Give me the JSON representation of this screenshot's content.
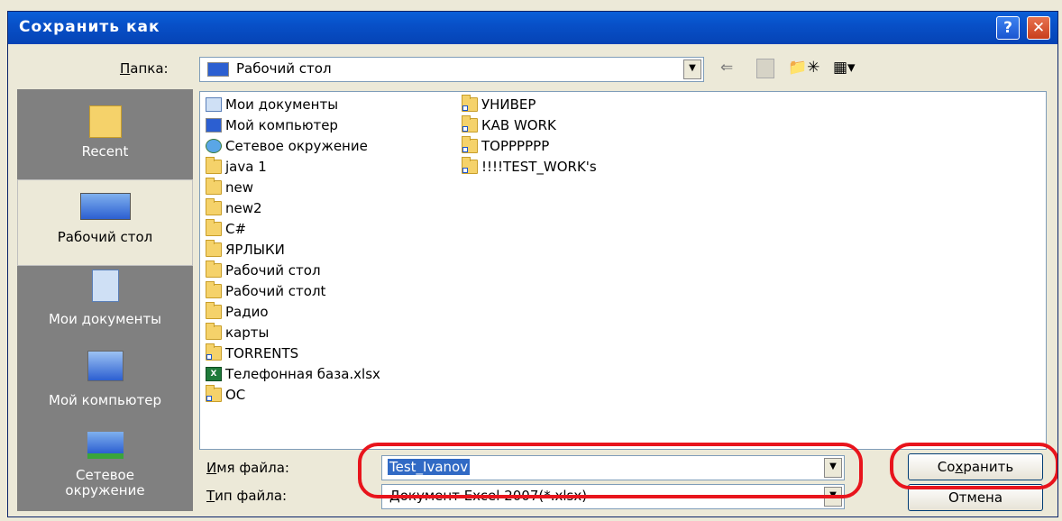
{
  "dialog": {
    "title": "Сохранить как",
    "help_glyph": "?",
    "close_glyph": "✕"
  },
  "folder_bar": {
    "label_u": "П",
    "label_rest": "апка:",
    "selected": "Рабочий стол",
    "icons": [
      "back-icon",
      "up-folder-icon",
      "new-folder-icon",
      "views-icon"
    ]
  },
  "places": [
    {
      "label": "Recent",
      "icon": "recent-folder-icon"
    },
    {
      "label": "Рабочий стол",
      "icon": "desktop-icon"
    },
    {
      "label": "Мои документы",
      "icon": "my-documents-icon"
    },
    {
      "label": "Мой компьютер",
      "icon": "my-computer-icon"
    },
    {
      "label_line1": "Сетевое",
      "label_line2": "окружение",
      "icon": "network-icon"
    }
  ],
  "files_col1": [
    {
      "name": "Мои документы",
      "icon": "my-documents-icon"
    },
    {
      "name": "Мой компьютер",
      "icon": "my-computer-icon"
    },
    {
      "name": "Сетевое окружение",
      "icon": "network-icon"
    },
    {
      "name": "java 1",
      "icon": "folder-icon"
    },
    {
      "name": "new",
      "icon": "folder-icon"
    },
    {
      "name": "new2",
      "icon": "folder-icon"
    },
    {
      "name": "C#",
      "icon": "folder-icon"
    },
    {
      "name": "ЯРЛЫКИ",
      "icon": "folder-icon"
    },
    {
      "name": "Рабочий стол",
      "icon": "folder-icon"
    },
    {
      "name": "Рабочий столt",
      "icon": "folder-icon"
    },
    {
      "name": "Радио",
      "icon": "folder-icon"
    },
    {
      "name": "карты",
      "icon": "folder-icon"
    },
    {
      "name": "TORRENTS",
      "icon": "folder-shortcut-icon"
    },
    {
      "name": "Телефонная база.xlsx",
      "icon": "excel-file-icon"
    },
    {
      "name": "OC",
      "icon": "folder-shortcut-icon"
    }
  ],
  "files_col2": [
    {
      "name": "УНИВЕР",
      "icon": "folder-shortcut-icon"
    },
    {
      "name": "КАВ WORK",
      "icon": "folder-shortcut-icon"
    },
    {
      "name": "TOPPPPPP",
      "icon": "folder-shortcut-icon"
    },
    {
      "name": "!!!!TEST_WORK's",
      "icon": "folder-shortcut-icon"
    }
  ],
  "filename": {
    "label_u": "И",
    "label_rest": "мя файла:",
    "value": "Test_Ivanov"
  },
  "filetype": {
    "label_u": "Т",
    "label_rest": "ип файла:",
    "value": "Документ Excel 2007(*.xlsx)"
  },
  "buttons": {
    "save_pre": "Со",
    "save_u": "х",
    "save_post": "ранить",
    "cancel": "Отмена"
  },
  "colors": {
    "titlebar": "#0a5fd8",
    "highlight": "#e8141c",
    "places_bg": "#808080"
  }
}
